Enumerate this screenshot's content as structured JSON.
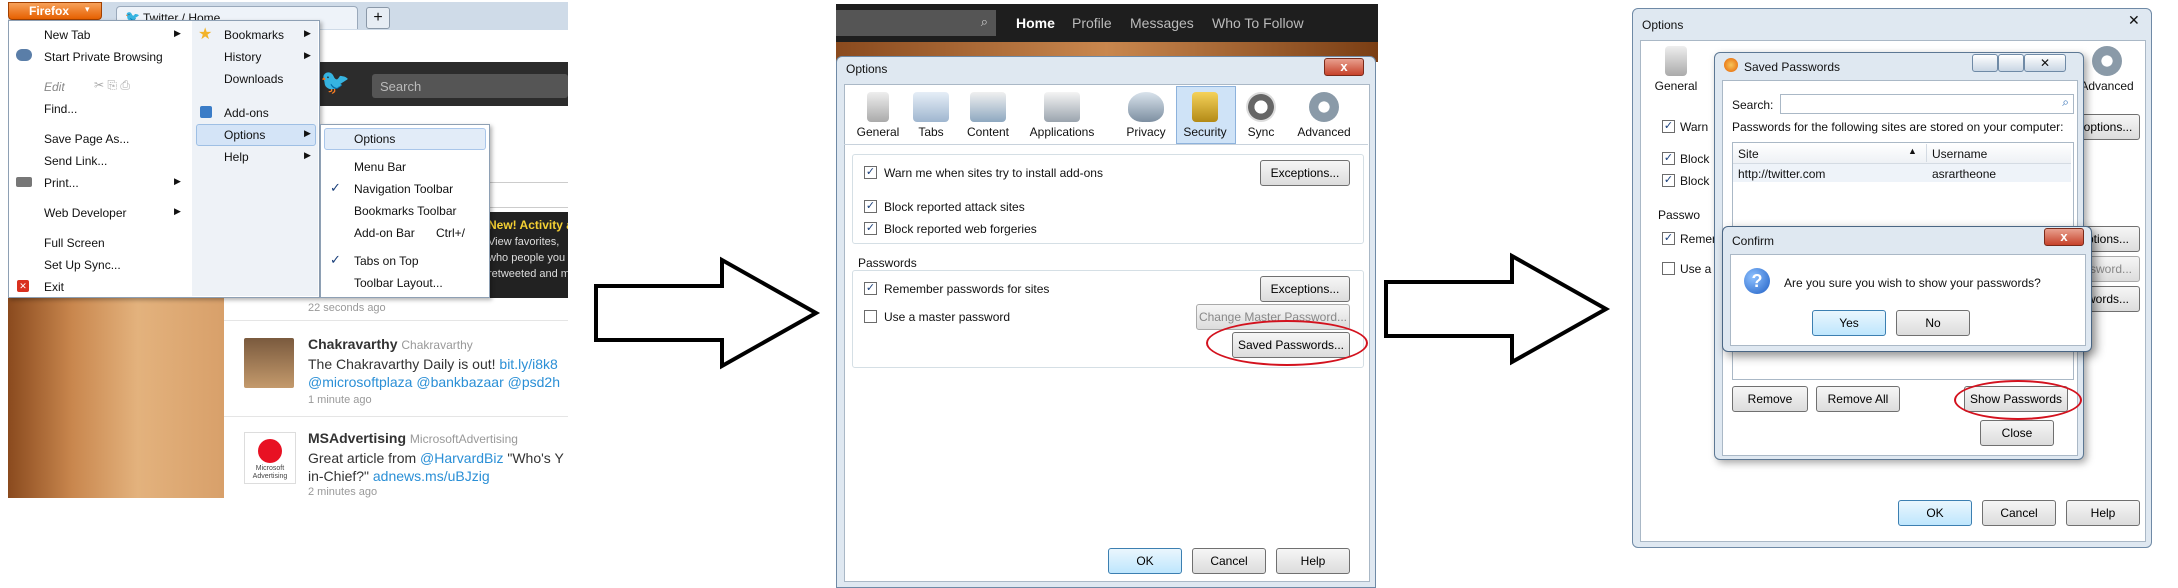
{
  "panel1": {
    "app_button": "Firefox",
    "tab_title": "Twitter / Home",
    "new_tab_plus": "+",
    "search_placeholder": "Search",
    "twitter_glyph": "🐦",
    "menu_left": {
      "new_tab": "New Tab",
      "private_browsing": "Start Private Browsing",
      "edit": "Edit",
      "find": "Find...",
      "save_page": "Save Page As...",
      "send_link": "Send Link...",
      "print": "Print...",
      "web_developer": "Web Developer",
      "full_screen": "Full Screen",
      "set_up_sync": "Set Up Sync...",
      "exit": "Exit"
    },
    "menu_right": {
      "bookmarks": "Bookmarks",
      "history": "History",
      "downloads": "Downloads",
      "addons": "Add-ons",
      "options": "Options",
      "help": "Help"
    },
    "submenu": {
      "options": "Options",
      "menu_bar": "Menu Bar",
      "navigation_toolbar": "Navigation Toolbar",
      "bookmarks_toolbar": "Bookmarks Toolbar",
      "addon_bar": "Add-on Bar",
      "addon_bar_shortcut": "Ctrl+/",
      "tabs_on_top": "Tabs on Top",
      "toolbar_layout": "Toolbar Layout..."
    },
    "promo": {
      "heading": "New! Activity a",
      "line1": "View favorites,",
      "line2": "who people you fo",
      "line3": "retweeted and m"
    },
    "tweets": [
      {
        "time": "22 seconds ago"
      },
      {
        "name": "Chakravarthy",
        "handle": "Chakravarthy",
        "text_a": "The Chakravarthy Daily is out! ",
        "link_a": "bit.ly/i8k8",
        "mentions": "@microsoftplaza @bankbazaar @psd2h",
        "time": "1 minute ago"
      },
      {
        "name": "MSAdvertising",
        "handle": "MicrosoftAdvertising",
        "text_a": "Great article from ",
        "link_a": "@HarvardBiz",
        "text_b": " \"Who's Y",
        "line2_a": "in-Chief?\" ",
        "line2_link": "adnews.ms/uBJzig",
        "time": "2 minutes ago",
        "logo_text": "Microsoft Advertising"
      }
    ]
  },
  "panel2": {
    "nav": {
      "home": "Home",
      "profile": "Profile",
      "messages": "Messages",
      "who_to_follow": "Who To Follow"
    },
    "dialog_title": "Options",
    "tabs": [
      "General",
      "Tabs",
      "Content",
      "Applications",
      "Privacy",
      "Security",
      "Sync",
      "Advanced"
    ],
    "warn_addons": "Warn me when sites try to install add-ons",
    "exceptions": "Exceptions...",
    "block_attack": "Block reported attack sites",
    "block_forgeries": "Block reported web forgeries",
    "passwords_heading": "Passwords",
    "remember_passwords": "Remember passwords for sites",
    "use_master": "Use a master password",
    "change_master": "Change Master Password...",
    "saved_passwords": "Saved Passwords...",
    "ok": "OK",
    "cancel": "Cancel",
    "help": "Help",
    "close_glyph": "x"
  },
  "panel3": {
    "options_title": "Options",
    "tab_general": "General",
    "tab_advanced": "Advanced",
    "warn_partial": "Warn",
    "block_partial_1": "Block",
    "block_partial_2": "Block",
    "passwords_partial": "Passwo",
    "remember_partial": "Remen",
    "use_partial": "Use a",
    "options_btn_partial": "options...",
    "exceptions_btn_partial": "ptions...",
    "password_btn_partial": "ssword...",
    "words_btn_partial": "words...",
    "ok": "OK",
    "cancel": "Cancel",
    "help": "Help",
    "saved_title": "Saved Passwords",
    "search_label": "Search:",
    "stored_text": "Passwords for the following sites are stored on your computer:",
    "col_site": "Site",
    "col_username": "Username",
    "row_site": "http://twitter.com",
    "row_username": "asrartheone",
    "remove": "Remove",
    "remove_all": "Remove All",
    "show_passwords": "Show Passwords",
    "close": "Close",
    "confirm_title": "Confirm",
    "confirm_question": "Are you sure you wish to show your passwords?",
    "yes": "Yes",
    "no": "No",
    "question_glyph": "?",
    "close_glyph": "x"
  },
  "colors": {
    "firefox_orange": "#e66000",
    "highlight_red": "#d3121e",
    "twitter_blue": "#2a8fd6",
    "security_tab": "#cfe3f7"
  }
}
